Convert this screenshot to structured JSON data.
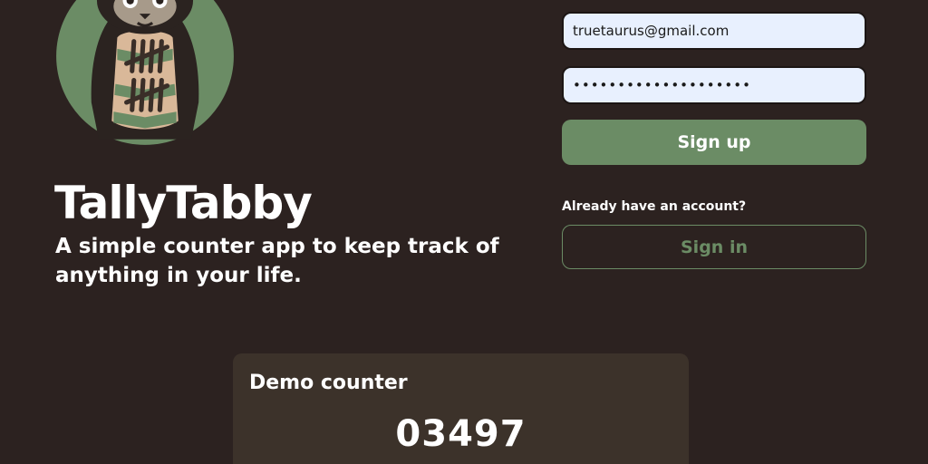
{
  "app": {
    "title": "TallyTabby",
    "tagline": "A simple counter app to keep track of anything in your life."
  },
  "signup_form": {
    "email_value": "truetaurus@gmail.com",
    "password_value": "••••••••••••••••••••",
    "signup_label": "Sign up",
    "account_prompt": "Already have an account?",
    "signin_label": "Sign in"
  },
  "demo_counter": {
    "title": "Demo counter",
    "count": "03497"
  },
  "colors": {
    "background": "#2c2220",
    "accent": "#6b8c65",
    "card": "#3c322a",
    "input_bg": "#e8f0fe"
  },
  "icons": {
    "logo": "tabby-cat-tally-logo"
  }
}
